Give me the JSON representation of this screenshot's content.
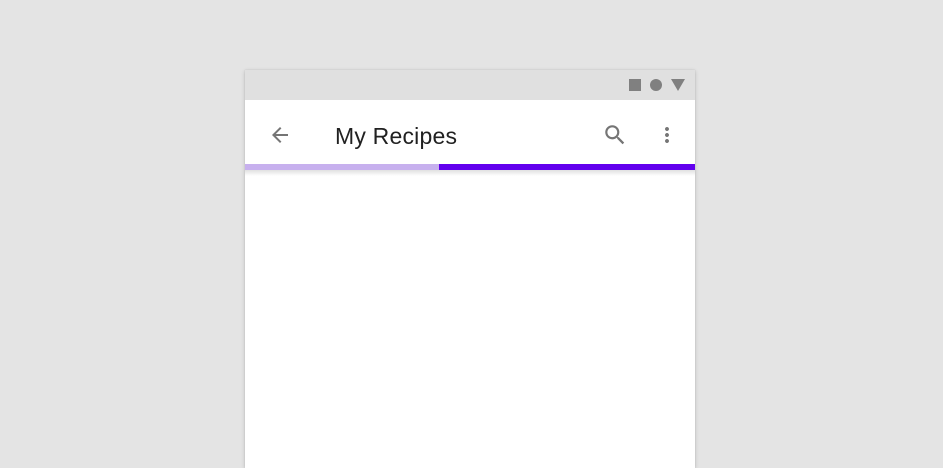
{
  "status_bar": {
    "icons": [
      "square-icon",
      "circle-icon",
      "triangle-icon"
    ]
  },
  "app_bar": {
    "title": "My Recipes",
    "nav_icon": "back-arrow-icon",
    "actions": [
      "search-icon",
      "more-vert-icon"
    ]
  },
  "progress": {
    "value": 0.43,
    "track_color": "#6200ee",
    "fill_color": "#c7b0ee"
  },
  "colors": {
    "background": "#e4e4e4",
    "surface": "#ffffff",
    "status_bar": "#e0e0e0",
    "icon": "#757575",
    "primary": "#6200ee"
  }
}
